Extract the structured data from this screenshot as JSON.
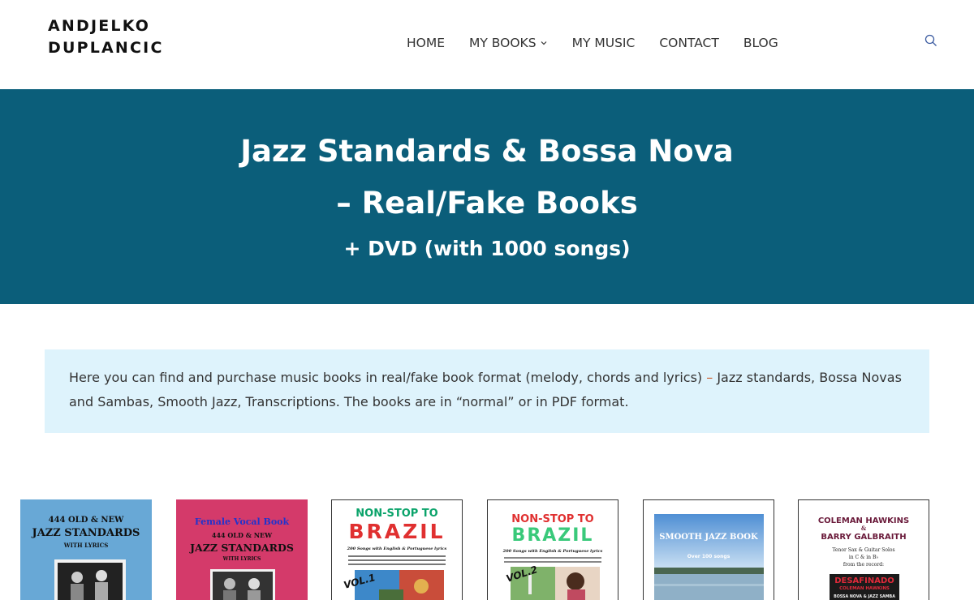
{
  "site": {
    "logo_line1": "ANDJELKO",
    "logo_line2": "DUPLANCIC"
  },
  "nav": {
    "items": [
      {
        "label": "HOME"
      },
      {
        "label": "MY BOOKS"
      },
      {
        "label": "MY MUSIC"
      },
      {
        "label": "CONTACT"
      },
      {
        "label": "BLOG"
      }
    ],
    "search_icon": "search-icon"
  },
  "hero": {
    "title_line1": "Jazz Standards & Bossa Nova",
    "title_line2": "– Real/Fake Books",
    "subtitle": "+ DVD (with 1000 songs)"
  },
  "intro": {
    "text_part1": "Here you can find and purchase music books in real/fake book format (melody, chords and lyrics) ",
    "dash": "–",
    "text_part2": " Jazz standards, Bossa Novas and Sambas, Smooth Jazz, Transcriptions. The books are in “normal” or in PDF format."
  },
  "books": [
    {
      "line1": "444 OLD & NEW",
      "line2": "JAZZ STANDARDS",
      "line3": "WITH LYRICS"
    },
    {
      "line0": "Female Vocal Book",
      "line1": "444 OLD & NEW",
      "line2": "JAZZ STANDARDS",
      "line3": "WITH LYRICS"
    },
    {
      "line1": "NON-STOP TO",
      "line2": "BRAZIL",
      "line3": "200 Songs with English & Portuguese lyrics",
      "vol": "VOL.1"
    },
    {
      "line1": "NON-STOP TO",
      "line2": "BRAZIL",
      "line3": "200 Songs with English & Portuguese lyrics",
      "vol": "VOL.2"
    },
    {
      "line1": "SMOOTH JAZZ BOOK",
      "line2": "Over 100 songs"
    },
    {
      "line1": "COLEMAN HAWKINS",
      "line2": "&",
      "line3": "BARRY GALBRAITH",
      "line4": "Tenor Sax & Guitar Solos",
      "line5": "in C & in B♭",
      "line6": "from the record:",
      "line7": "DESAFINADO",
      "line8": "COLEMAN HAWKINS",
      "line9": "BOSSA NOVA & JAZZ SAMBA"
    }
  ],
  "colors": {
    "hero_bg": "#0b5e7a",
    "intro_bg": "#def3fc",
    "accent_dash": "#cc5b2a"
  }
}
